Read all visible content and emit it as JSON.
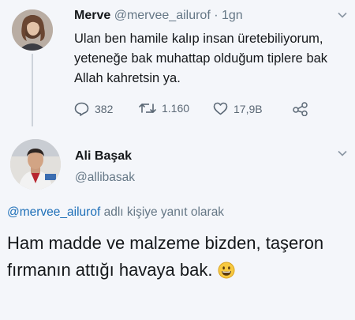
{
  "tweet1": {
    "name": "Merve",
    "handle": "@mervee_ailurof",
    "time": "· 1gn",
    "text": "Ulan ben hamile kalıp insan üretebiliyorum, yeteneğe bak muhattap olduğum tiplere bak Allah kahretsin ya.",
    "replies": "382",
    "retweets": "1.160",
    "likes": "17,9B"
  },
  "tweet2": {
    "name": "Ali Başak",
    "handle": "@allibasak",
    "reply_mention": "@mervee_ailurof",
    "reply_suffix": " adlı kişiye yanıt olarak",
    "text": "Ham madde ve malzeme bizden, taşeron fırmanın attığı havaya bak.",
    "emoji": "grinning-face-icon"
  },
  "colors": {
    "background": "#f4f6fa",
    "text": "#14171a",
    "secondary": "#657786",
    "link": "#1d6fb8"
  }
}
